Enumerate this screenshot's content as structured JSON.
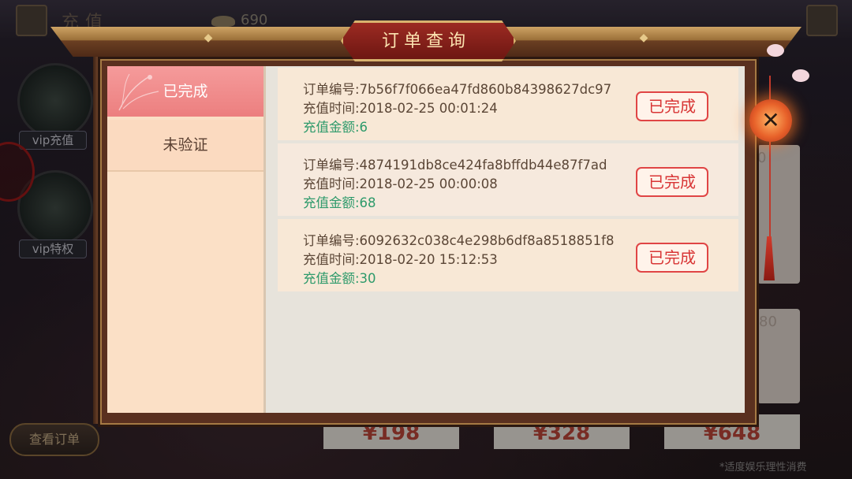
{
  "background": {
    "title": "充值",
    "gold_value": "690",
    "side_items": [
      {
        "label": "vip充值"
      },
      {
        "label": "vip特权"
      }
    ],
    "check_orders_label": "查看订单",
    "price_cards": [
      "¥198",
      "¥328",
      "¥648"
    ],
    "right_card_values": [
      "0",
      "80"
    ],
    "hint": "*适度娱乐理性消费"
  },
  "dialog": {
    "title": "订单查询",
    "tabs": [
      {
        "label": "已完成",
        "active": true
      },
      {
        "label": "未验证",
        "active": false
      }
    ],
    "orders": [
      {
        "order_no": "订单编号:7b56f7f066ea47fd860b84398627dc97",
        "time": "充值时间:2018-02-25 00:01:24",
        "amount": "充值金额:6",
        "status": "已完成"
      },
      {
        "order_no": "订单编号:4874191db8ce424fa8bffdb44e87f7ad",
        "time": "充值时间:2018-02-25 00:00:08",
        "amount": "充值金额:68",
        "status": "已完成"
      },
      {
        "order_no": "订单编号:6092632c038c4e298b6df8a8518851f8",
        "time": "充值时间:2018-02-20 15:12:53",
        "amount": "充值金额:30",
        "status": "已完成"
      }
    ],
    "close_icon": "close-icon"
  },
  "colors": {
    "active_tab": "#ec7f7f",
    "status_red": "#d83535",
    "amount_green": "#2e9a6b"
  }
}
